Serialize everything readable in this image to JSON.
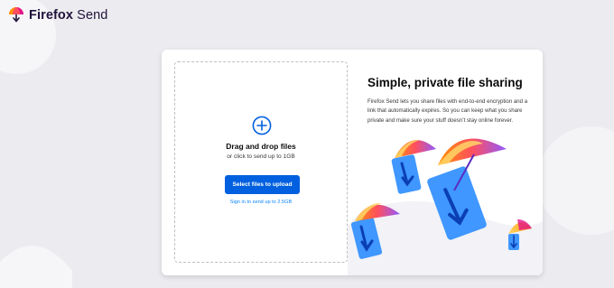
{
  "header": {
    "brand_bold": "Firefox",
    "brand_rest": " Send",
    "logo_icon": "firefox-send-umbrella-icon"
  },
  "upload": {
    "icon": "plus-circle-icon",
    "title": "Drag and drop files",
    "subtitle": "or click to send up to 1GB",
    "button_label": "Select files to upload",
    "signin_link": "Sign in to send up to 2.5GB"
  },
  "info": {
    "title": "Simple, private file sharing",
    "description": "Firefox Send lets you share files with end-to-end encryption and a link that automatically expires. So you can keep what you share private and make sure your stuff doesn’t stay online forever."
  },
  "colors": {
    "accent": "#0060df",
    "link": "#0a84ff",
    "page_bg": "#ececf0"
  }
}
